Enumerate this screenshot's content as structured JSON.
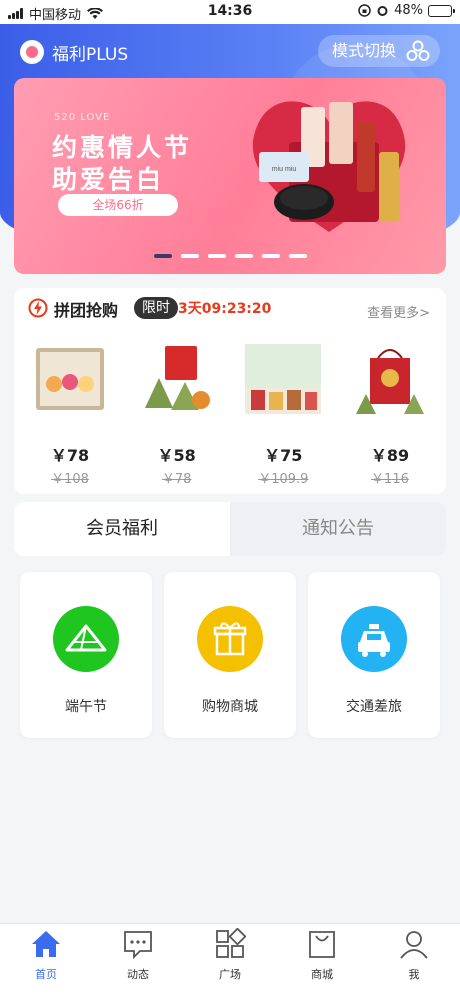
{
  "status_bar": {
    "carrier": "中国移动",
    "time": "14:36",
    "battery": "48%",
    "battery_level": 0.48
  },
  "header": {
    "title": "福利PLUS",
    "mode_switch_label": "模式切换"
  },
  "banner": {
    "subtitle": "520 LOVE",
    "title_line1": "约惠情人节",
    "title_line2": "助爱告白",
    "tag": "全场66折",
    "product_brand": "miu miu",
    "slide_count": 6,
    "active_slide": 1
  },
  "group_buy": {
    "title": "拼团抢购",
    "badge": "限时",
    "countdown": "3天09:23:20",
    "more_link": "查看更多>",
    "products": [
      {
        "price": "￥78",
        "original_price": "￥108"
      },
      {
        "price": "￥58",
        "original_price": "￥78"
      },
      {
        "price": "￥75",
        "original_price": "￥109.9"
      },
      {
        "price": "￥89",
        "original_price": "￥116"
      }
    ]
  },
  "tabs": [
    {
      "label": "会员福利",
      "active": true
    },
    {
      "label": "通知公告",
      "active": false
    }
  ],
  "cards": [
    {
      "label": "端午节",
      "color": "#1fc61f",
      "icon": "zongzi-icon"
    },
    {
      "label": "购物商城",
      "color": "#f5c000",
      "icon": "gift-icon"
    },
    {
      "label": "交通差旅",
      "color": "#23b3f3",
      "icon": "taxi-icon"
    }
  ],
  "bottom_nav": [
    {
      "label": "首页",
      "icon": "home-icon",
      "active": true
    },
    {
      "label": "动态",
      "icon": "chat-icon",
      "active": false
    },
    {
      "label": "广场",
      "icon": "grid-icon",
      "active": false
    },
    {
      "label": "商城",
      "icon": "bag-icon",
      "active": false
    },
    {
      "label": "我",
      "icon": "user-icon",
      "active": false
    }
  ],
  "colors": {
    "primary": "#3b6cf0",
    "accent_red": "#e63a1f",
    "banner_pink": "#ff7e98"
  }
}
